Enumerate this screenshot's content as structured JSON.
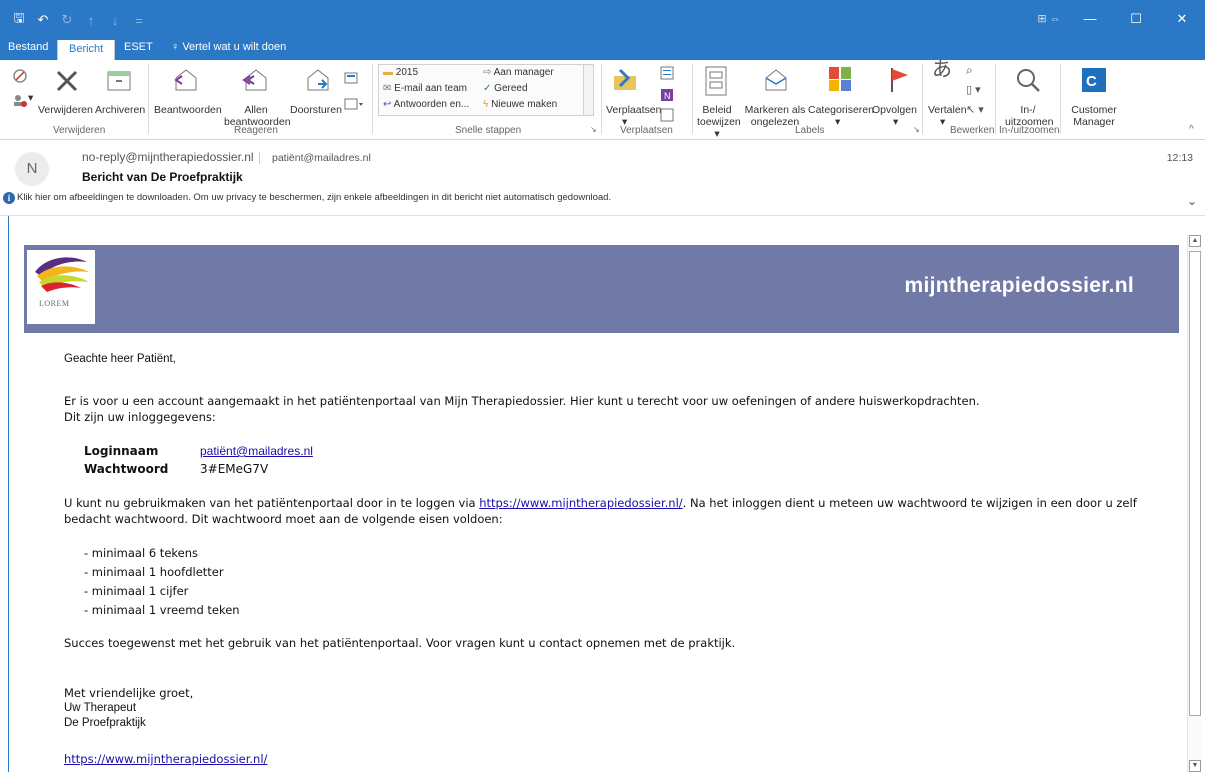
{
  "qat": {
    "save": "🖫",
    "undo": "↶",
    "redo": "↻",
    "up": "↑",
    "down": "↓",
    "more": "="
  },
  "window": {
    "ribbon_display": "⊞ ⇔",
    "minimize": "—",
    "maximize": "☐",
    "close": "✕"
  },
  "tabs": {
    "bestand": "Bestand",
    "bericht": "Bericht",
    "eset": "ESET",
    "tell": "Vertel wat u wilt doen"
  },
  "ribbon": {
    "verwijderen": "Verwijderen",
    "archiveren": "Archiveren",
    "beantwoorden": "Beantwoorden",
    "allen1": "Allen",
    "allen2": "beantwoorden",
    "doorsturen": "Doorsturen",
    "qs_2015": "2015",
    "qs_manager": "Aan manager",
    "qs_email_team": "E-mail aan team",
    "qs_gereed": "Gereed",
    "qs_antwoorden": "Antwoorden en...",
    "qs_nieuwe": "Nieuwe maken",
    "verplaatsen": "Verplaatsen",
    "beleid1": "Beleid",
    "beleid2": "toewijzen",
    "markeren1": "Markeren als",
    "markeren2": "ongelezen",
    "categoriseren": "Categoriseren",
    "opvolgen": "Opvolgen",
    "vertalen": "Vertalen",
    "zoom1": "In-/",
    "zoom2": "uitzoomen",
    "customer1": "Customer",
    "customer2": "Manager",
    "groups": {
      "verwijderen": "Verwijderen",
      "reageren": "Reageren",
      "snelle": "Snelle stappen",
      "verplaatsen": "Verplaatsen",
      "labels": "Labels",
      "bewerken": "Bewerken",
      "zoom": "In-/uitzoomen"
    }
  },
  "header": {
    "avatar": "N",
    "from": "no-reply@mijntherapiedossier.nl",
    "to": "patiënt@mailadres.nl",
    "time": "12:13",
    "subject": "Bericht van De Proefpraktijk",
    "info": "Klik hier om afbeeldingen te downloaden. Om uw privacy te beschermen, zijn enkele afbeeldingen in dit bericht niet automatisch gedownload."
  },
  "email": {
    "logo_text": "LOREM",
    "site_name": "mijntherapiedossier.nl",
    "greeting": "Geachte heer Patiënt,",
    "intro1": "Er is voor u een account aangemaakt in het patiëntenportaal van Mijn Therapiedossier. Hier kunt u terecht voor uw oefeningen of andere huiswerkopdrachten.",
    "intro2": "Dit zijn uw inloggegevens:",
    "login_label": "Loginnaam",
    "login_value": "patiënt@mailadres.nl",
    "password_label": "Wachtwoord",
    "password_value": "3#EMeG7V",
    "use1_pre": "U kunt nu gebruikmaken van het patiëntenportaal door in te loggen via ",
    "use1_link": "https://www.mijntherapiedossier.nl/",
    "use1_post": ". Na het inloggen dient u meteen uw wachtwoord te wijzigen in een door u zelf",
    "use2": "bedacht wachtwoord. Dit wachtwoord moet aan de volgende eisen voldoen:",
    "requirements": [
      "- minimaal 6 tekens",
      "- minimaal 1 hoofdletter",
      "- minimaal 1 cijfer",
      "- minimaal 1 vreemd teken"
    ],
    "success": "Succes toegewenst met het gebruik van het patiëntenportaal. Voor vragen kunt u contact opnemen met de praktijk.",
    "closing": "Met vriendelijke groet,",
    "sig1": "Uw Therapeut",
    "sig2": "De Proefpraktijk",
    "footer_link": "https://www.mijntherapiedossier.nl/"
  }
}
